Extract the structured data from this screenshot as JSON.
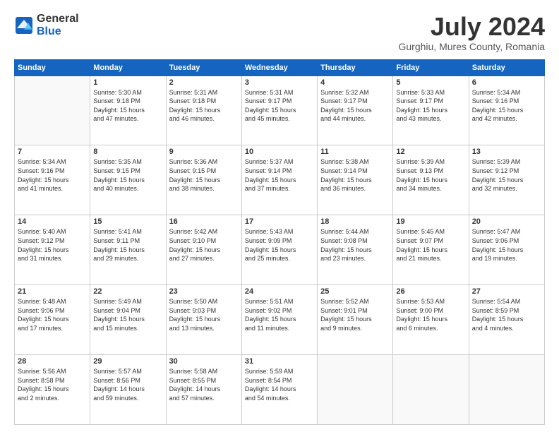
{
  "logo": {
    "general": "General",
    "blue": "Blue"
  },
  "title": {
    "month_year": "July 2024",
    "location": "Gurghiu, Mures County, Romania"
  },
  "header_days": [
    "Sunday",
    "Monday",
    "Tuesday",
    "Wednesday",
    "Thursday",
    "Friday",
    "Saturday"
  ],
  "weeks": [
    [
      {
        "day": "",
        "info": ""
      },
      {
        "day": "1",
        "info": "Sunrise: 5:30 AM\nSunset: 9:18 PM\nDaylight: 15 hours\nand 47 minutes."
      },
      {
        "day": "2",
        "info": "Sunrise: 5:31 AM\nSunset: 9:18 PM\nDaylight: 15 hours\nand 46 minutes."
      },
      {
        "day": "3",
        "info": "Sunrise: 5:31 AM\nSunset: 9:17 PM\nDaylight: 15 hours\nand 45 minutes."
      },
      {
        "day": "4",
        "info": "Sunrise: 5:32 AM\nSunset: 9:17 PM\nDaylight: 15 hours\nand 44 minutes."
      },
      {
        "day": "5",
        "info": "Sunrise: 5:33 AM\nSunset: 9:17 PM\nDaylight: 15 hours\nand 43 minutes."
      },
      {
        "day": "6",
        "info": "Sunrise: 5:34 AM\nSunset: 9:16 PM\nDaylight: 15 hours\nand 42 minutes."
      }
    ],
    [
      {
        "day": "7",
        "info": "Sunrise: 5:34 AM\nSunset: 9:16 PM\nDaylight: 15 hours\nand 41 minutes."
      },
      {
        "day": "8",
        "info": "Sunrise: 5:35 AM\nSunset: 9:15 PM\nDaylight: 15 hours\nand 40 minutes."
      },
      {
        "day": "9",
        "info": "Sunrise: 5:36 AM\nSunset: 9:15 PM\nDaylight: 15 hours\nand 38 minutes."
      },
      {
        "day": "10",
        "info": "Sunrise: 5:37 AM\nSunset: 9:14 PM\nDaylight: 15 hours\nand 37 minutes."
      },
      {
        "day": "11",
        "info": "Sunrise: 5:38 AM\nSunset: 9:14 PM\nDaylight: 15 hours\nand 36 minutes."
      },
      {
        "day": "12",
        "info": "Sunrise: 5:39 AM\nSunset: 9:13 PM\nDaylight: 15 hours\nand 34 minutes."
      },
      {
        "day": "13",
        "info": "Sunrise: 5:39 AM\nSunset: 9:12 PM\nDaylight: 15 hours\nand 32 minutes."
      }
    ],
    [
      {
        "day": "14",
        "info": "Sunrise: 5:40 AM\nSunset: 9:12 PM\nDaylight: 15 hours\nand 31 minutes."
      },
      {
        "day": "15",
        "info": "Sunrise: 5:41 AM\nSunset: 9:11 PM\nDaylight: 15 hours\nand 29 minutes."
      },
      {
        "day": "16",
        "info": "Sunrise: 5:42 AM\nSunset: 9:10 PM\nDaylight: 15 hours\nand 27 minutes."
      },
      {
        "day": "17",
        "info": "Sunrise: 5:43 AM\nSunset: 9:09 PM\nDaylight: 15 hours\nand 25 minutes."
      },
      {
        "day": "18",
        "info": "Sunrise: 5:44 AM\nSunset: 9:08 PM\nDaylight: 15 hours\nand 23 minutes."
      },
      {
        "day": "19",
        "info": "Sunrise: 5:45 AM\nSunset: 9:07 PM\nDaylight: 15 hours\nand 21 minutes."
      },
      {
        "day": "20",
        "info": "Sunrise: 5:47 AM\nSunset: 9:06 PM\nDaylight: 15 hours\nand 19 minutes."
      }
    ],
    [
      {
        "day": "21",
        "info": "Sunrise: 5:48 AM\nSunset: 9:06 PM\nDaylight: 15 hours\nand 17 minutes."
      },
      {
        "day": "22",
        "info": "Sunrise: 5:49 AM\nSunset: 9:04 PM\nDaylight: 15 hours\nand 15 minutes."
      },
      {
        "day": "23",
        "info": "Sunrise: 5:50 AM\nSunset: 9:03 PM\nDaylight: 15 hours\nand 13 minutes."
      },
      {
        "day": "24",
        "info": "Sunrise: 5:51 AM\nSunset: 9:02 PM\nDaylight: 15 hours\nand 11 minutes."
      },
      {
        "day": "25",
        "info": "Sunrise: 5:52 AM\nSunset: 9:01 PM\nDaylight: 15 hours\nand 9 minutes."
      },
      {
        "day": "26",
        "info": "Sunrise: 5:53 AM\nSunset: 9:00 PM\nDaylight: 15 hours\nand 6 minutes."
      },
      {
        "day": "27",
        "info": "Sunrise: 5:54 AM\nSunset: 8:59 PM\nDaylight: 15 hours\nand 4 minutes."
      }
    ],
    [
      {
        "day": "28",
        "info": "Sunrise: 5:56 AM\nSunset: 8:58 PM\nDaylight: 15 hours\nand 2 minutes."
      },
      {
        "day": "29",
        "info": "Sunrise: 5:57 AM\nSunset: 8:56 PM\nDaylight: 14 hours\nand 59 minutes."
      },
      {
        "day": "30",
        "info": "Sunrise: 5:58 AM\nSunset: 8:55 PM\nDaylight: 14 hours\nand 57 minutes."
      },
      {
        "day": "31",
        "info": "Sunrise: 5:59 AM\nSunset: 8:54 PM\nDaylight: 14 hours\nand 54 minutes."
      },
      {
        "day": "",
        "info": ""
      },
      {
        "day": "",
        "info": ""
      },
      {
        "day": "",
        "info": ""
      }
    ]
  ]
}
